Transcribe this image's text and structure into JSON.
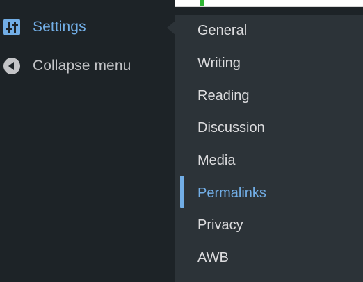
{
  "sidebar": {
    "settings": {
      "label": "Settings",
      "icon": "sliders-icon"
    },
    "collapse": {
      "label": "Collapse menu",
      "icon": "collapse-arrow-icon"
    }
  },
  "submenu": {
    "items": [
      {
        "label": "General",
        "current": false
      },
      {
        "label": "Writing",
        "current": false
      },
      {
        "label": "Reading",
        "current": false
      },
      {
        "label": "Discussion",
        "current": false
      },
      {
        "label": "Media",
        "current": false
      },
      {
        "label": "Permalinks",
        "current": true
      },
      {
        "label": "Privacy",
        "current": false
      },
      {
        "label": "AWB",
        "current": false
      }
    ]
  },
  "colors": {
    "sidebar_bg": "#1d2327",
    "submenu_bg": "#2c3338",
    "accent": "#72aee6",
    "text": "#dcdcde",
    "topbar_accent": "#2fb534"
  }
}
